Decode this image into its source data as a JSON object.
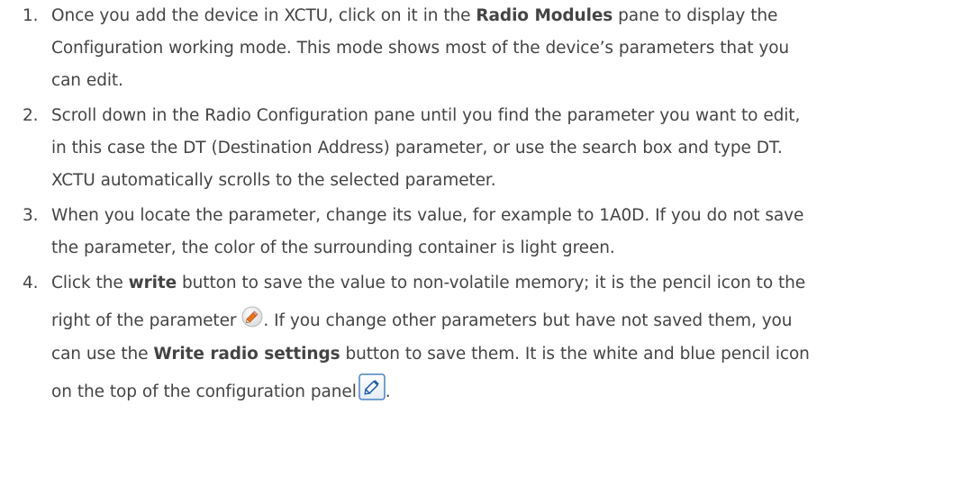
{
  "steps": [
    {
      "number": "1.",
      "line1_pre": "Once you add the device in XCTU, click on it in the ",
      "line1_bold": "Radio Modules",
      "line1_post": " pane to display the",
      "line2": "Configuration working mode. This mode shows most of the device’s parameters that you",
      "line3": "can edit."
    },
    {
      "number": "2.",
      "line1": "Scroll down in the Radio Configuration pane until you find the parameter you want to edit,",
      "line2": "in this case the DT (Destination Address) parameter, or use the search box and type DT.",
      "line3": "XCTU automatically scrolls to the selected parameter."
    },
    {
      "number": "3.",
      "line1": "When you locate the parameter, change its value, for example to 1A0D. If you do not save",
      "line2": "the parameter, the color of the surrounding container is light green."
    },
    {
      "number": "4.",
      "line1_pre": "Click the ",
      "line1_bold": "write",
      "line1_post": " button to save the value to non-volatile memory; it is the pencil icon to the",
      "line2_pre": "right of the parameter",
      "line2_post": ". If you change other parameters but have not saved them, you",
      "line3_pre": "can use the ",
      "line3_bold": "Write radio settings",
      "line3_post": " button to save them. It is the white and blue pencil icon",
      "line4_pre": "on the top of the configuration panel",
      "line4_post": "."
    }
  ],
  "icons": {
    "write_parameter": "pencil-round-icon",
    "write_radio_settings": "pencil-square-icon"
  }
}
